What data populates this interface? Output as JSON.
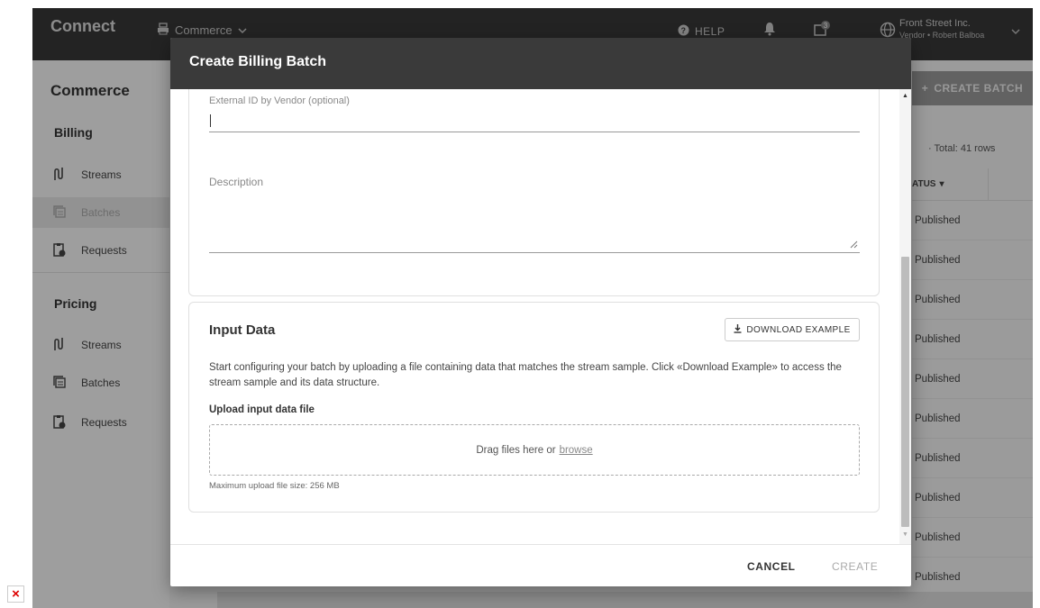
{
  "topbar": {
    "app_name": "Connect",
    "module": "Commerce",
    "help": "HELP",
    "chat_badge": "3",
    "account_name": "Front Street Inc.",
    "account_sub": "Vendor • Robert Balboa"
  },
  "sidebar": {
    "title": "Commerce",
    "sections": [
      {
        "label": "Billing",
        "items": [
          {
            "label": "Streams"
          },
          {
            "label": "Batches"
          },
          {
            "label": "Requests"
          }
        ]
      },
      {
        "label": "Pricing",
        "items": [
          {
            "label": "Streams"
          },
          {
            "label": "Batches"
          },
          {
            "label": "Requests"
          }
        ]
      }
    ]
  },
  "background": {
    "create_batch_label": "CREATE BATCH",
    "total_rows": "Total: 41 rows",
    "status_header": "ATUS",
    "row_status": [
      "Published",
      "Published",
      "Published",
      "Published",
      "Published",
      "Published",
      "Published",
      "Published",
      "Published",
      "Published"
    ]
  },
  "modal": {
    "title": "Create Billing Batch",
    "external_id_label": "External ID by Vendor (optional)",
    "external_id_value": "",
    "description_label": "Description",
    "description_value": "",
    "input_data": {
      "title": "Input Data",
      "download_label": "DOWNLOAD EXAMPLE",
      "description": "Start configuring your batch by uploading a file containing data that matches the stream sample. Click «Download Example» to access the stream sample and its data structure.",
      "upload_label": "Upload input data file",
      "drop_text": "Drag files here or",
      "browse_link": "browse",
      "max_size": "Maximum upload file size: 256 MB"
    },
    "cancel_label": "CANCEL",
    "create_label": "CREATE"
  },
  "colors": {
    "topbar": "#383838",
    "modal_header": "#3a3a3a",
    "overlay": "rgba(0,0,0,0.36)"
  },
  "icons": [
    "printer-icon",
    "chevron-down-icon",
    "help-icon",
    "bell-icon",
    "chat-icon",
    "globe-icon",
    "streams-icon",
    "batches-icon",
    "requests-icon",
    "download-icon",
    "plus-icon",
    "sort-down-icon",
    "broken-image-icon"
  ]
}
